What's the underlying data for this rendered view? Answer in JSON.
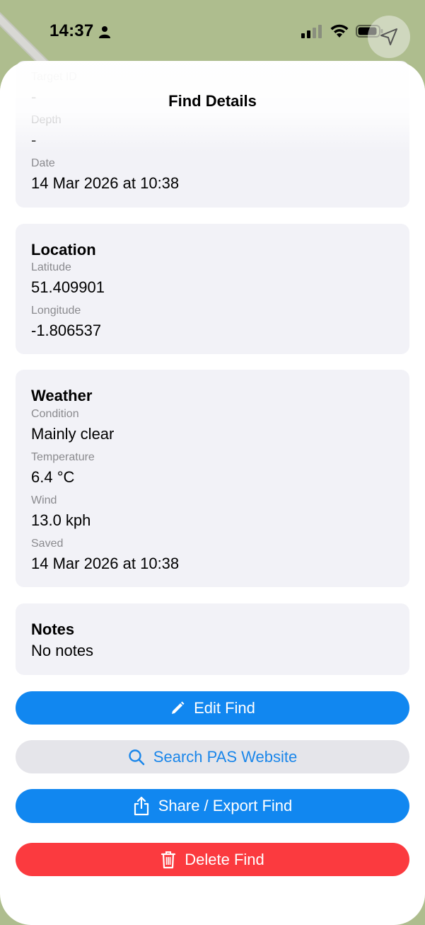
{
  "status_bar": {
    "time": "14:37"
  },
  "sheet": {
    "title": "Find Details"
  },
  "details_card": {
    "target_id_label": "Target ID",
    "target_id_value": "-",
    "depth_label": "Depth",
    "depth_value": "-",
    "date_label": "Date",
    "date_value": "14 Mar 2026 at 10:38"
  },
  "location_card": {
    "title": "Location",
    "latitude_label": "Latitude",
    "latitude_value": "51.409901",
    "longitude_label": "Longitude",
    "longitude_value": "-1.806537"
  },
  "weather_card": {
    "title": "Weather",
    "condition_label": "Condition",
    "condition_value": "Mainly clear",
    "temperature_label": "Temperature",
    "temperature_value": "6.4 °C",
    "wind_label": "Wind",
    "wind_value": "13.0 kph",
    "saved_label": "Saved",
    "saved_value": "14 Mar 2026 at 10:38"
  },
  "notes_card": {
    "title": "Notes",
    "value": "No notes"
  },
  "actions": {
    "edit_label": "Edit Find",
    "search_label": "Search PAS Website",
    "share_label": "Share / Export Find",
    "delete_label": "Delete Find"
  },
  "colors": {
    "primary": "#1187f0",
    "danger": "#fb3a3f",
    "card_bg": "#f2f2f7",
    "secondary_bg": "#e5e5ea"
  }
}
